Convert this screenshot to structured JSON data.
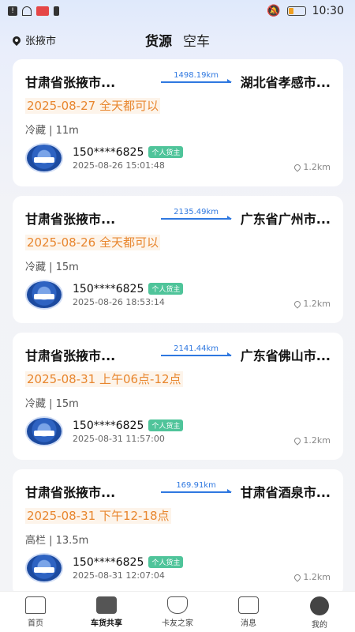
{
  "status_bar": {
    "time": "10:30",
    "icons": [
      "alert-icon",
      "wifi-icon",
      "red-icon",
      "sim-icon",
      "mute-icon",
      "battery-icon"
    ]
  },
  "header": {
    "location": "张掖市",
    "tabs": [
      "货源",
      "空车"
    ]
  },
  "cards": [
    {
      "origin": "甘肃省张掖市...",
      "distance": "1498.19km",
      "destination": "湖北省孝感市...",
      "date": "2025-08-27 全天都可以",
      "spec": "冷藏 | 11m",
      "phone": "150****6825",
      "badge": "个人货主",
      "time": "2025-08-26 15:01:48",
      "nearby": "1.2km"
    },
    {
      "origin": "甘肃省张掖市...",
      "distance": "2135.49km",
      "destination": "广东省广州市...",
      "date": "2025-08-26 全天都可以",
      "spec": "冷藏 | 15m",
      "phone": "150****6825",
      "badge": "个人货主",
      "time": "2025-08-26 18:53:14",
      "nearby": "1.2km"
    },
    {
      "origin": "甘肃省张掖市...",
      "distance": "2141.44km",
      "destination": "广东省佛山市...",
      "date": "2025-08-31 上午06点-12点",
      "spec": "冷藏 | 15m",
      "phone": "150****6825",
      "badge": "个人货主",
      "time": "2025-08-31 11:57:00",
      "nearby": "1.2km"
    },
    {
      "origin": "甘肃省张掖市...",
      "distance": "169.91km",
      "destination": "甘肃省酒泉市...",
      "date": "2025-08-31 下午12-18点",
      "spec": "高栏 | 13.5m",
      "phone": "150****6825",
      "badge": "个人货主",
      "time": "2025-08-31 12:07:04",
      "nearby": "1.2km"
    }
  ],
  "bottom_nav": [
    {
      "label": "首页",
      "icon": "home-icon"
    },
    {
      "label": "车货共享",
      "icon": "truck-icon"
    },
    {
      "label": "卡友之家",
      "icon": "shield-icon"
    },
    {
      "label": "消息",
      "icon": "chat-icon"
    },
    {
      "label": "我的",
      "icon": "profile-icon"
    }
  ]
}
